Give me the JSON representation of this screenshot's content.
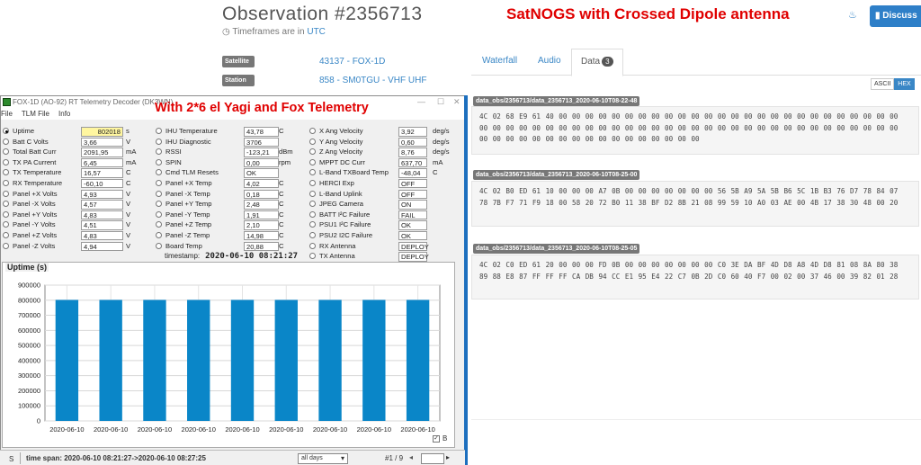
{
  "page": {
    "title": "Observation #2356713",
    "timeframe_note": "Timeframes are in",
    "timeframe_link": "UTC",
    "overlay_heading": "SatNOGS with Crossed Dipole antenna",
    "discuss_label": "Discuss"
  },
  "meta": [
    {
      "label": "Satellite",
      "value": "43137 - FOX-1D"
    },
    {
      "label": "Station",
      "value": "858 - SM0TGU - VHF UHF"
    }
  ],
  "tabs": [
    {
      "label": "Waterfall"
    },
    {
      "label": "Audio"
    },
    {
      "label": "Data",
      "badge": "3"
    }
  ],
  "format_toggle": {
    "ascii": "ASCII",
    "hex": "HEX"
  },
  "frames": [
    {
      "name": "data_obs/2356713/data_2356713_2020-06-10T08-22-48",
      "hex": "4C 02 68 E9 61 40 00 00 00 00 00 00 00 00 00 00 00 00 00 00 00 00 00 00 00 00 00 00 00 00 00 00 00 00 00 00 00 00 00 00 00 00 00 00 00 00 00 00 00 00 00 00 00 00 00 00 00 00 00 00 00 00 00 00 00 00 00 00 00 00 00 00 00 00 00 00 00 00 00 00 00"
    },
    {
      "name": "data_obs/2356713/data_2356713_2020-06-10T08-25-00",
      "hex": "4C 02 B0 ED 61 10 00 00 00 A7 0B 00 00 00 00 00 00 00 56 5B A9 5A 5B B6 5C 1B B3 76 D7 78 84 07 78 7B F7 71 F9 18 00 58 20 72 B0 11 38 BF D2 8B 21 08 99 59 10 A0 03 AE 00 4B 17 38 30 48 00 20"
    },
    {
      "name": "data_obs/2356713/data_2356713_2020-06-10T08-25-05",
      "hex": "4C 02 C0 ED 61 20 00 00 00 FD 0B 00 00 00 00 00 00 00 C0 3E DA BF 4D D8 A8 4D D8 81 08 8A 80 38 89 88 E8 87 FF FF FF CA DB 94 CC E1 95 E4 22 C7 0B 2D C0 60 40 F7 00 02 00 37 46 00 39 82 01 28"
    }
  ],
  "window": {
    "title": "FOX-1D (AO-92) RT Telemetry Decoder (DK3WN)",
    "menus": [
      "File",
      "TLM File",
      "Info"
    ],
    "overlay_heading": "With 2*6 el Yagi and Fox Telemetry",
    "timestamp_label": "timestamp:",
    "timestamp_value": "2020-06-10 08:21:27",
    "legend_label": "B"
  },
  "telemetry": {
    "col1": [
      {
        "label": "Uptime",
        "value": "802018",
        "unit": "s",
        "selected": true
      },
      {
        "label": "Batt C Volts",
        "value": "3,66",
        "unit": "V"
      },
      {
        "label": "Total Batt Curr",
        "value": "2091,95",
        "unit": "mA"
      },
      {
        "label": "TX PA Current",
        "value": "6,45",
        "unit": "mA"
      },
      {
        "label": "TX Temperature",
        "value": "16,57",
        "unit": "C"
      },
      {
        "label": "RX Temperature",
        "value": "-60,10",
        "unit": "C"
      },
      {
        "label": "Panel +X Volts",
        "value": "4,93",
        "unit": "V"
      },
      {
        "label": "Panel -X Volts",
        "value": "4,57",
        "unit": "V"
      },
      {
        "label": "Panel +Y Volts",
        "value": "4,83",
        "unit": "V"
      },
      {
        "label": "Panel -Y Volts",
        "value": "4,51",
        "unit": "V"
      },
      {
        "label": "Panel +Z Volts",
        "value": "4,83",
        "unit": "V"
      },
      {
        "label": "Panel -Z Volts",
        "value": "4,94",
        "unit": "V"
      }
    ],
    "col2": [
      {
        "label": "IHU Temperature",
        "value": "43,78",
        "unit": "C"
      },
      {
        "label": "IHU Diagnostic",
        "value": "3706",
        "unit": ""
      },
      {
        "label": "RSSI",
        "value": "-123,21",
        "unit": "dBm"
      },
      {
        "label": "SPIN",
        "value": "0,00",
        "unit": "rpm"
      },
      {
        "label": "Cmd TLM Resets",
        "value": "OK",
        "unit": ""
      },
      {
        "label": "Panel +X Temp",
        "value": "4,02",
        "unit": "C"
      },
      {
        "label": "Panel -X Temp",
        "value": "0,18",
        "unit": "C"
      },
      {
        "label": "Panel +Y Temp",
        "value": "2,48",
        "unit": "C"
      },
      {
        "label": "Panel -Y Temp",
        "value": "1,91",
        "unit": "C"
      },
      {
        "label": "Panel +Z Temp",
        "value": "2,10",
        "unit": "C"
      },
      {
        "label": "Panel -Z Temp",
        "value": "14,98",
        "unit": "C"
      },
      {
        "label": "Board Temp",
        "value": "20,88",
        "unit": "C"
      }
    ],
    "col3": [
      {
        "label": "X Ang Velocity",
        "value": "3,92",
        "unit": "deg/s"
      },
      {
        "label": "Y Ang Velocity",
        "value": "0,60",
        "unit": "deg/s"
      },
      {
        "label": "Z Ang Velocity",
        "value": "8,76",
        "unit": "deg/s"
      },
      {
        "label": "MPPT DC Curr",
        "value": "637,70",
        "unit": "mA"
      },
      {
        "label": "L-Band TXBoard Temp",
        "value": "-48,04",
        "unit": "C"
      },
      {
        "label": "HERCI Exp",
        "value": "OFF",
        "unit": ""
      },
      {
        "label": "L-Band Uplink",
        "value": "OFF",
        "unit": ""
      },
      {
        "label": "JPEG Camera",
        "value": "ON",
        "unit": ""
      },
      {
        "label": "BATT I²C Failure",
        "value": "FAIL",
        "unit": ""
      },
      {
        "label": "PSU1 I²C Failure",
        "value": "OK",
        "unit": ""
      },
      {
        "label": "PSU2 I2C Failure",
        "value": "OK",
        "unit": ""
      },
      {
        "label": "RX Antenna",
        "value": "DEPLOY",
        "unit": ""
      },
      {
        "label": "TX Antenna",
        "value": "DEPLOY",
        "unit": ""
      }
    ]
  },
  "chart_data": {
    "type": "bar",
    "title": "Uptime (s)",
    "categories": [
      "2020-06-10",
      "2020-06-10",
      "2020-06-10",
      "2020-06-10",
      "2020-06-10",
      "2020-06-10",
      "2020-06-10",
      "2020-06-10",
      "2020-06-10"
    ],
    "values": [
      802018,
      802018,
      802018,
      802018,
      802018,
      802018,
      802018,
      802018,
      802018
    ],
    "ylim": [
      0,
      900000
    ],
    "yticks": [
      0,
      100000,
      200000,
      300000,
      400000,
      500000,
      600000,
      700000,
      800000,
      900000
    ],
    "grid": true,
    "color": "#0a86c8"
  },
  "statusbar": {
    "s_label": "S",
    "time_span": "time span: 2020-06-10 08:21:27->2020-06-10 08:27:25",
    "range_select": "all days",
    "page": "#1 / 9"
  },
  "colors": {
    "accent": "#3a87c6",
    "highlight_red": "#e00000",
    "bar": "#0a86c8"
  }
}
